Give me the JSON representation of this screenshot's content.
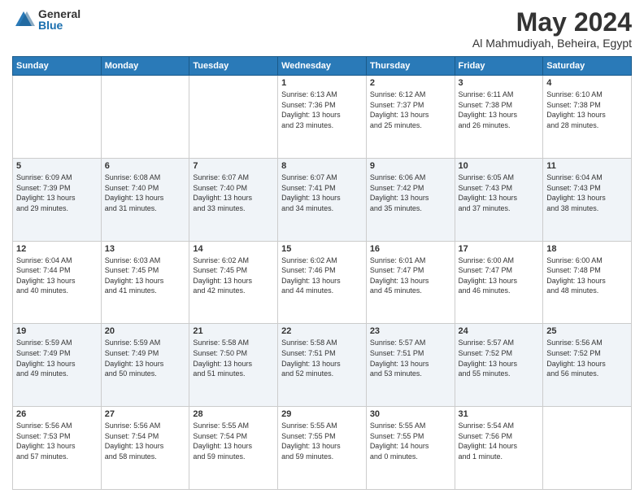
{
  "logo": {
    "general": "General",
    "blue": "Blue"
  },
  "title": {
    "month": "May 2024",
    "location": "Al Mahmudiyah, Beheira, Egypt"
  },
  "calendar": {
    "headers": [
      "Sunday",
      "Monday",
      "Tuesday",
      "Wednesday",
      "Thursday",
      "Friday",
      "Saturday"
    ],
    "weeks": [
      [
        {
          "day": "",
          "info": ""
        },
        {
          "day": "",
          "info": ""
        },
        {
          "day": "",
          "info": ""
        },
        {
          "day": "1",
          "info": "Sunrise: 6:13 AM\nSunset: 7:36 PM\nDaylight: 13 hours\nand 23 minutes."
        },
        {
          "day": "2",
          "info": "Sunrise: 6:12 AM\nSunset: 7:37 PM\nDaylight: 13 hours\nand 25 minutes."
        },
        {
          "day": "3",
          "info": "Sunrise: 6:11 AM\nSunset: 7:38 PM\nDaylight: 13 hours\nand 26 minutes."
        },
        {
          "day": "4",
          "info": "Sunrise: 6:10 AM\nSunset: 7:38 PM\nDaylight: 13 hours\nand 28 minutes."
        }
      ],
      [
        {
          "day": "5",
          "info": "Sunrise: 6:09 AM\nSunset: 7:39 PM\nDaylight: 13 hours\nand 29 minutes."
        },
        {
          "day": "6",
          "info": "Sunrise: 6:08 AM\nSunset: 7:40 PM\nDaylight: 13 hours\nand 31 minutes."
        },
        {
          "day": "7",
          "info": "Sunrise: 6:07 AM\nSunset: 7:40 PM\nDaylight: 13 hours\nand 33 minutes."
        },
        {
          "day": "8",
          "info": "Sunrise: 6:07 AM\nSunset: 7:41 PM\nDaylight: 13 hours\nand 34 minutes."
        },
        {
          "day": "9",
          "info": "Sunrise: 6:06 AM\nSunset: 7:42 PM\nDaylight: 13 hours\nand 35 minutes."
        },
        {
          "day": "10",
          "info": "Sunrise: 6:05 AM\nSunset: 7:43 PM\nDaylight: 13 hours\nand 37 minutes."
        },
        {
          "day": "11",
          "info": "Sunrise: 6:04 AM\nSunset: 7:43 PM\nDaylight: 13 hours\nand 38 minutes."
        }
      ],
      [
        {
          "day": "12",
          "info": "Sunrise: 6:04 AM\nSunset: 7:44 PM\nDaylight: 13 hours\nand 40 minutes."
        },
        {
          "day": "13",
          "info": "Sunrise: 6:03 AM\nSunset: 7:45 PM\nDaylight: 13 hours\nand 41 minutes."
        },
        {
          "day": "14",
          "info": "Sunrise: 6:02 AM\nSunset: 7:45 PM\nDaylight: 13 hours\nand 42 minutes."
        },
        {
          "day": "15",
          "info": "Sunrise: 6:02 AM\nSunset: 7:46 PM\nDaylight: 13 hours\nand 44 minutes."
        },
        {
          "day": "16",
          "info": "Sunrise: 6:01 AM\nSunset: 7:47 PM\nDaylight: 13 hours\nand 45 minutes."
        },
        {
          "day": "17",
          "info": "Sunrise: 6:00 AM\nSunset: 7:47 PM\nDaylight: 13 hours\nand 46 minutes."
        },
        {
          "day": "18",
          "info": "Sunrise: 6:00 AM\nSunset: 7:48 PM\nDaylight: 13 hours\nand 48 minutes."
        }
      ],
      [
        {
          "day": "19",
          "info": "Sunrise: 5:59 AM\nSunset: 7:49 PM\nDaylight: 13 hours\nand 49 minutes."
        },
        {
          "day": "20",
          "info": "Sunrise: 5:59 AM\nSunset: 7:49 PM\nDaylight: 13 hours\nand 50 minutes."
        },
        {
          "day": "21",
          "info": "Sunrise: 5:58 AM\nSunset: 7:50 PM\nDaylight: 13 hours\nand 51 minutes."
        },
        {
          "day": "22",
          "info": "Sunrise: 5:58 AM\nSunset: 7:51 PM\nDaylight: 13 hours\nand 52 minutes."
        },
        {
          "day": "23",
          "info": "Sunrise: 5:57 AM\nSunset: 7:51 PM\nDaylight: 13 hours\nand 53 minutes."
        },
        {
          "day": "24",
          "info": "Sunrise: 5:57 AM\nSunset: 7:52 PM\nDaylight: 13 hours\nand 55 minutes."
        },
        {
          "day": "25",
          "info": "Sunrise: 5:56 AM\nSunset: 7:52 PM\nDaylight: 13 hours\nand 56 minutes."
        }
      ],
      [
        {
          "day": "26",
          "info": "Sunrise: 5:56 AM\nSunset: 7:53 PM\nDaylight: 13 hours\nand 57 minutes."
        },
        {
          "day": "27",
          "info": "Sunrise: 5:56 AM\nSunset: 7:54 PM\nDaylight: 13 hours\nand 58 minutes."
        },
        {
          "day": "28",
          "info": "Sunrise: 5:55 AM\nSunset: 7:54 PM\nDaylight: 13 hours\nand 59 minutes."
        },
        {
          "day": "29",
          "info": "Sunrise: 5:55 AM\nSunset: 7:55 PM\nDaylight: 13 hours\nand 59 minutes."
        },
        {
          "day": "30",
          "info": "Sunrise: 5:55 AM\nSunset: 7:55 PM\nDaylight: 14 hours\nand 0 minutes."
        },
        {
          "day": "31",
          "info": "Sunrise: 5:54 AM\nSunset: 7:56 PM\nDaylight: 14 hours\nand 1 minute."
        },
        {
          "day": "",
          "info": ""
        }
      ]
    ]
  }
}
